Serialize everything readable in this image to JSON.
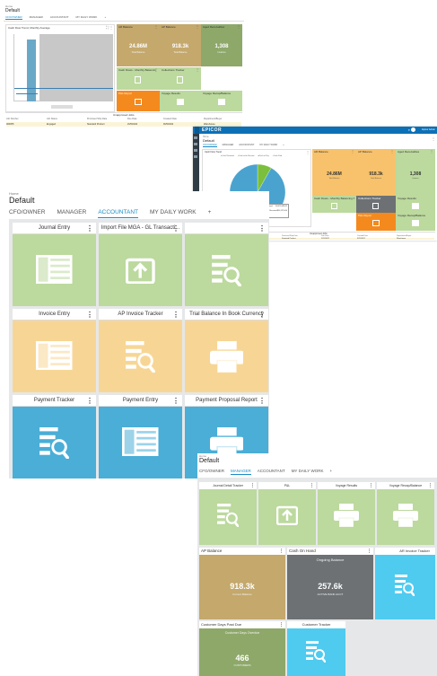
{
  "colors": {
    "tan": "#c4a86c",
    "green": "#bcd99e",
    "olive": "#8ea86a",
    "orange": "#f7d695",
    "orange_dark": "#f48a1e",
    "blue": "#4aaed7",
    "cyan": "#4fcbf0",
    "gray": "#6d7174",
    "accent": "#1a8bc4",
    "epicor_bar": "#0c70b6"
  },
  "shot1": {
    "breadcrumb": "Home",
    "title": "Default",
    "tabs": [
      "CFO/OWNER",
      "MANAGER",
      "ACCOUNTANT",
      "MY DAILY WORK",
      "+"
    ],
    "active_tab": "CFO/OWNER",
    "chart_title": "Cash Flow Trend, Monthly Average",
    "tiles": {
      "ar_balance": {
        "label": "AR Balance",
        "value": "24.86M",
        "sub": "Total Balance"
      },
      "ap_balance": {
        "label": "AP Balance",
        "value": "918.3k",
        "sub": "Total Balance"
      },
      "aged_receivables": {
        "label": "Aged Receivables",
        "value": "1,308",
        "sub": "Invoices"
      },
      "cash_flows": {
        "label": "Cash Flows - Monthly Balancing Se..."
      },
      "collections": {
        "label": "Collections Tracker"
      },
      "pnl_report": {
        "label": "P&L Report"
      },
      "voyage_results": {
        "label": "Voyage Results"
      },
      "voyage_recap": {
        "label": "Voyage Recap/Balance"
      }
    },
    "table_title": "Unapproved Jobs",
    "table_cols": [
      "Job Number",
      "Job Status",
      "Promised Ship Date",
      "Due Date",
      "Created Date",
      "Department/Buyer"
    ],
    "table_row": [
      "000055",
      "Engaged",
      "Standard Product",
      "2/25/2022",
      "9/25/2022",
      "Warehouse"
    ]
  },
  "shot2": {
    "brand": "EPICOR",
    "user": "Epicor Admin",
    "breadcrumb": "Home",
    "title": "Default",
    "tabs": [
      "CFO/OWNER",
      "MANAGER",
      "ACCOUNTANT",
      "MY DAILY WORK",
      "+"
    ],
    "chart_title": "Cash Flow Trend",
    "legend": [
      "Cash Received",
      "Cash to be Receive",
      "Cash to Pay",
      "Cash Paid"
    ],
    "tooltip": {
      "line1": "Cash Received",
      "value1": "$4,476,038.61",
      "line2": "Cash to be Received",
      "value2": "$50,127,000"
    },
    "tiles": {
      "ar_balance": {
        "label": "AR Balance",
        "value": "24.86M",
        "sub": "Total Balance"
      },
      "ap_balance": {
        "label": "AP Balance",
        "value": "918.3k",
        "sub": "Total Balance"
      },
      "aged_receivables": {
        "label": "Aged Receivables",
        "value": "1,308",
        "sub": "Invoices"
      },
      "cash_flows": {
        "label": "Cash Flows - Monthly Balancing Sel..."
      },
      "collections": {
        "label": "Collections Tracker"
      },
      "voyage_results": {
        "label": "Voyage Results"
      },
      "pnl_report": {
        "label": "P&L Report"
      },
      "voyage_recap": {
        "label": "Voyage Recap/Balance"
      }
    },
    "table_title": "Unapproved Jobs",
    "table_cols": [
      "Job Number",
      "Job Status",
      "Promised Ship Date",
      "Due Date",
      "Created Date",
      "Department/Buyer"
    ],
    "table_row": [
      "000055",
      "Engaged",
      "Standard Product",
      "2/25/2022",
      "9/25/2022",
      "Warehouse"
    ],
    "chart_data": {
      "type": "pie",
      "categories": [
        "Cash Received",
        "Cash to be Received"
      ],
      "values": [
        4476038.61,
        50127000
      ]
    }
  },
  "shot3": {
    "breadcrumb": "Home",
    "title": "Default",
    "tabs": [
      "CFO/OWNER",
      "MANAGER",
      "ACCOUNTANT",
      "MY DAILY WORK",
      "+"
    ],
    "active_tab": "ACCOUNTANT",
    "tiles": [
      {
        "label": "Journal Entry",
        "color": "green",
        "icon": "form-icon"
      },
      {
        "label": "Import File MGA - GL Transacti...",
        "color": "green",
        "icon": "upload-icon"
      },
      {
        "label": "",
        "color": "green",
        "icon": "tracker-icon"
      },
      {
        "label": "Invoice Entry",
        "color": "orange",
        "icon": "form-icon"
      },
      {
        "label": "AP Invoice Tracker",
        "color": "orange",
        "icon": "tracker-icon"
      },
      {
        "label": "Trial Balance In Book Currency",
        "color": "orange",
        "icon": "print-icon"
      },
      {
        "label": "Payment Tracker",
        "color": "blue",
        "icon": "tracker-icon"
      },
      {
        "label": "Payment Entry",
        "color": "blue",
        "icon": "form-icon"
      },
      {
        "label": "Payment Proposal Report",
        "color": "blue",
        "icon": "print-icon"
      }
    ]
  },
  "shot4": {
    "breadcrumb": "Home",
    "title": "Default",
    "tabs": [
      "CFO/OWNER",
      "MANAGER",
      "ACCOUNTANT",
      "MY DAILY WORK",
      "+"
    ],
    "active_tab": "MANAGER",
    "row1": [
      {
        "label": "Journal Detail Tracker",
        "icon": "tracker-icon"
      },
      {
        "label": "P&L",
        "icon": "upload-icon"
      },
      {
        "label": "Voyage Results",
        "icon": "print-icon"
      },
      {
        "label": "Voyage Recap/Balance",
        "icon": "print-icon"
      }
    ],
    "ap_balance": {
      "label": "AP Balance",
      "value": "918.3k",
      "sub": "Current Balance"
    },
    "cash_on_hand": {
      "label": "Cash On Hand",
      "inner": "Ongoing Balance",
      "value": "257.6k",
      "sub": "ACTIVE BANK ACCT"
    },
    "ar_invoice": {
      "label": "AR Invoice Tracker"
    },
    "customer_days": {
      "label": "Customer Days Past Due",
      "inner": "Customer Days Overdue",
      "value": "466",
      "sub": "CUSTOMERS"
    },
    "customer_tracker": {
      "label": "Customer Tracker"
    }
  }
}
